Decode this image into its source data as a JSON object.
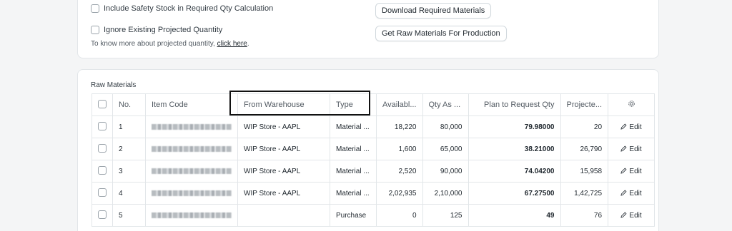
{
  "options": {
    "include_safety_stock_label": "Include Safety Stock in Required Qty Calculation",
    "ignore_projected_label": "Ignore Existing Projected Quantity",
    "hint_text": "To know more about projected quantity, ",
    "hint_link": "click here",
    "hint_suffix": "."
  },
  "buttons": {
    "download_label": "Download Required Materials",
    "get_raw_label": "Get Raw Materials For Production"
  },
  "raw_materials": {
    "title": "Raw Materials",
    "columns": [
      "No.",
      "Item Code",
      "From Warehouse",
      "Type",
      "Availabl...",
      "Qty As ...",
      "Plan to Request Qty",
      "Projecte..."
    ],
    "rows": [
      {
        "no": "1",
        "warehouse": "WIP Store - AAPL",
        "type": "Material ...",
        "available": "18,220",
        "qty_as": "80,000",
        "plan": "79.98000",
        "projected": "20",
        "edit": "Edit"
      },
      {
        "no": "2",
        "warehouse": "WIP Store - AAPL",
        "type": "Material ...",
        "available": "1,600",
        "qty_as": "65,000",
        "plan": "38.21000",
        "projected": "26,790",
        "edit": "Edit"
      },
      {
        "no": "3",
        "warehouse": "WIP Store - AAPL",
        "type": "Material ...",
        "available": "2,520",
        "qty_as": "90,000",
        "plan": "74.04200",
        "projected": "15,958",
        "edit": "Edit"
      },
      {
        "no": "4",
        "warehouse": "WIP Store - AAPL",
        "type": "Material ...",
        "available": "2,02,935",
        "qty_as": "2,10,000",
        "plan": "67.27500",
        "projected": "1,42,725",
        "edit": "Edit"
      },
      {
        "no": "5",
        "warehouse": "",
        "type": "Purchase",
        "available": "0",
        "qty_as": "125",
        "plan": "49",
        "projected": "76",
        "edit": "Edit"
      }
    ]
  }
}
